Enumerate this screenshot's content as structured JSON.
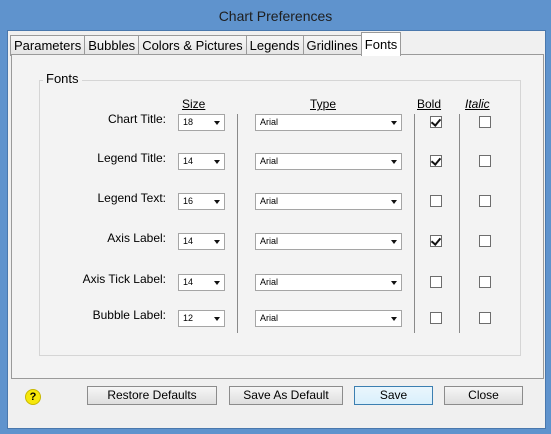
{
  "window": {
    "title": "Chart Preferences"
  },
  "tabs": [
    {
      "label": "Parameters",
      "active": false
    },
    {
      "label": "Bubbles",
      "active": false
    },
    {
      "label": "Colors & Pictures",
      "active": false
    },
    {
      "label": "Legends",
      "active": false
    },
    {
      "label": "Gridlines",
      "active": false
    },
    {
      "label": "Fonts",
      "active": true
    }
  ],
  "fonts_group": {
    "title": "Fonts",
    "headers": {
      "size": "Size",
      "type": "Type",
      "bold": "Bold",
      "italic": "Italic"
    },
    "rows": [
      {
        "label": "Chart Title:",
        "size": "18",
        "type": "Arial",
        "bold": true,
        "italic": false
      },
      {
        "label": "Legend Title:",
        "size": "14",
        "type": "Arial",
        "bold": true,
        "italic": false
      },
      {
        "label": "Legend Text:",
        "size": "16",
        "type": "Arial",
        "bold": false,
        "italic": false
      },
      {
        "label": "Axis Label:",
        "size": "14",
        "type": "Arial",
        "bold": true,
        "italic": false
      },
      {
        "label": "Axis Tick Label:",
        "size": "14",
        "type": "Arial",
        "bold": false,
        "italic": false
      },
      {
        "label": "Bubble Label:",
        "size": "12",
        "type": "Arial",
        "bold": false,
        "italic": false
      }
    ]
  },
  "buttons": {
    "help": "?",
    "restore_defaults": "Restore Defaults",
    "save_as_default": "Save As Default",
    "save": "Save",
    "close": "Close"
  },
  "colors": {
    "titlebar": "#5f93cd",
    "help_icon": "#f6e70a",
    "default_button_border": "#3c7fb1"
  },
  "icons": {
    "checkbox_checked": "checkmark",
    "select_arrow": "triangle-down"
  }
}
